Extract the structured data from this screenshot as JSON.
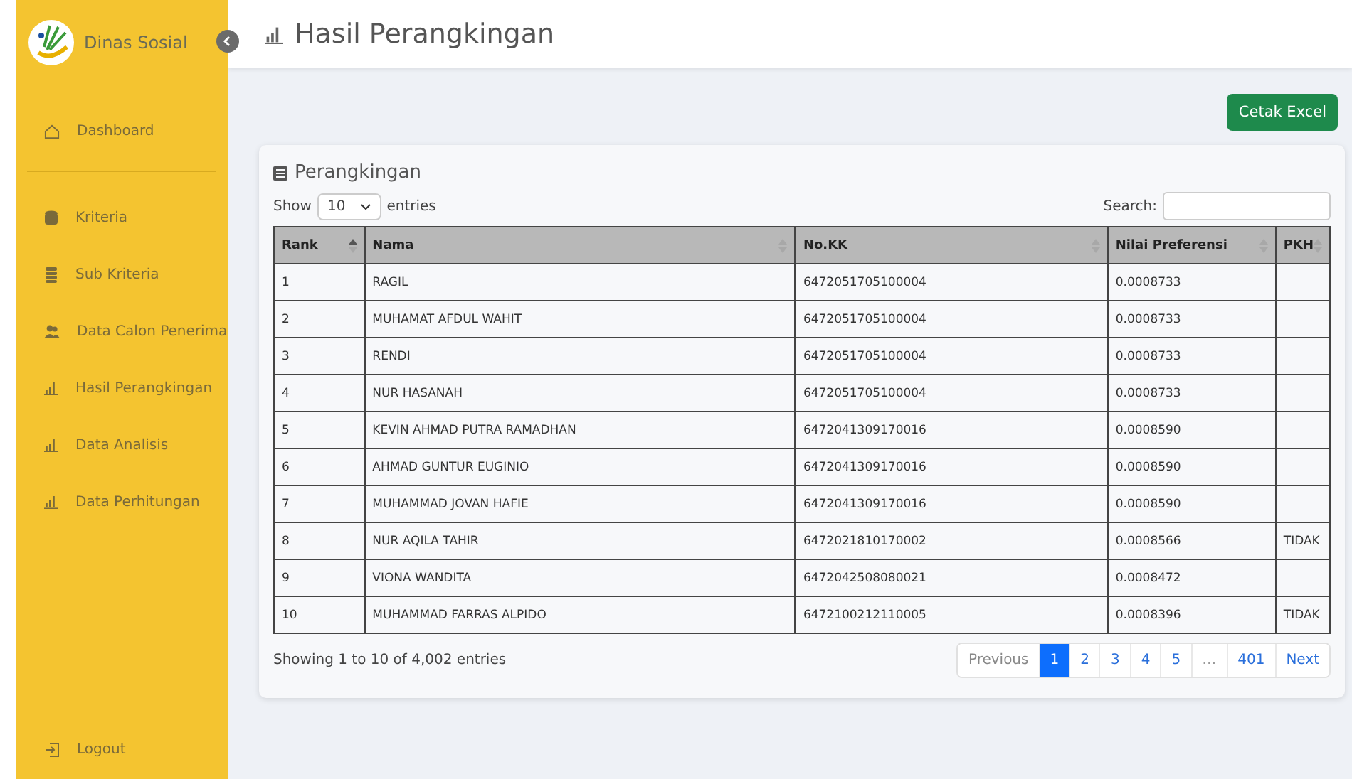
{
  "brand": {
    "name": "Dinas Sosial"
  },
  "sidebar": {
    "items": [
      {
        "label": "Dashboard",
        "selected": false
      },
      {
        "label": "Kriteria",
        "selected": false
      },
      {
        "label": "Sub Kriteria",
        "selected": false
      },
      {
        "label": "Data Calon Penerima",
        "selected": false
      },
      {
        "label": "Hasil Perangkingan",
        "selected": false
      },
      {
        "label": "Data Analisis",
        "selected": false
      },
      {
        "label": "Data Perhitungan",
        "selected": false
      }
    ],
    "logout": "Logout"
  },
  "page_title": "Hasil Perangkingan",
  "export_button": "Cetak Excel",
  "card": {
    "title": "Perangkingan",
    "length": {
      "prefix": "Show",
      "value": "10",
      "suffix": "entries"
    },
    "search": {
      "label": "Search:"
    },
    "table": {
      "columns": [
        {
          "label": "Rank",
          "sorted": true
        },
        {
          "label": "Nama",
          "sorted": false
        },
        {
          "label": "No.KK",
          "sorted": false
        },
        {
          "label": "Nilai Preferensi",
          "sorted": false
        },
        {
          "label": "PKH",
          "sorted": false
        }
      ],
      "rows": [
        [
          "1",
          "RAGIL",
          "6472051705100004",
          "0.0008733",
          ""
        ],
        [
          "2",
          "MUHAMAT AFDUL WAHIT",
          "6472051705100004",
          "0.0008733",
          ""
        ],
        [
          "3",
          "RENDI",
          "6472051705100004",
          "0.0008733",
          ""
        ],
        [
          "4",
          "NUR HASANAH",
          "6472051705100004",
          "0.0008733",
          ""
        ],
        [
          "5",
          "KEVIN AHMAD PUTRA RAMADHAN",
          "6472041309170016",
          "0.0008590",
          ""
        ],
        [
          "6",
          "AHMAD GUNTUR EUGINIO",
          "6472041309170016",
          "0.0008590",
          ""
        ],
        [
          "7",
          "MUHAMMAD JOVAN HAFIE",
          "6472041309170016",
          "0.0008590",
          ""
        ],
        [
          "8",
          "NUR AQILA TAHIR",
          "6472021810170002",
          "0.0008566",
          "TIDAK"
        ],
        [
          "9",
          "VIONA WANDITA",
          "6472042508080021",
          "0.0008472",
          ""
        ],
        [
          "10",
          "MUHAMMAD FARRAS ALPIDO",
          "6472100212110005",
          "0.0008396",
          "TIDAK"
        ]
      ]
    },
    "info": "Showing 1 to 10 of 4,002 entries",
    "pagination": [
      {
        "label": "Previous",
        "kind": "nav",
        "selected": false
      },
      {
        "label": "1",
        "kind": "page",
        "selected": true
      },
      {
        "label": "2",
        "kind": "page",
        "selected": false
      },
      {
        "label": "3",
        "kind": "page",
        "selected": false
      },
      {
        "label": "4",
        "kind": "page",
        "selected": false
      },
      {
        "label": "5",
        "kind": "page",
        "selected": false
      },
      {
        "label": "…",
        "kind": "ellipsis",
        "selected": false
      },
      {
        "label": "401",
        "kind": "page",
        "selected": false
      },
      {
        "label": "Next",
        "kind": "nav",
        "selected": false
      }
    ]
  }
}
